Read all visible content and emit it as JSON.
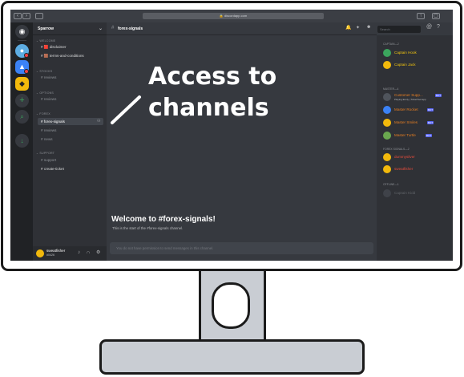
{
  "browser": {
    "url": "discordapp.com"
  },
  "server": {
    "name": "Sparrow"
  },
  "channel_list": {
    "categories": [
      {
        "label": "WELCOME",
        "channels": [
          "disclaimer",
          "terms-and-conditions"
        ]
      },
      {
        "label": "STOCKS",
        "channels": [
          "reviews"
        ]
      },
      {
        "label": "OPTIONS",
        "channels": [
          "reviews"
        ]
      },
      {
        "label": "FOREX",
        "channels": [
          "forex-signals",
          "reviews",
          "news"
        ]
      },
      {
        "label": "SUPPORT",
        "channels": [
          "support",
          "create-ticket"
        ]
      }
    ]
  },
  "header": {
    "channel": "forex-signals",
    "search_placeholder": "Search"
  },
  "overlay": {
    "line1": "Access to",
    "line2": "channels"
  },
  "welcome": {
    "title": "Welcome to #forex-signals!",
    "subtitle": "This is the start of the #forex-signals channel."
  },
  "composer": {
    "placeholder": "You do not have permission to send messages in this channel."
  },
  "user": {
    "name": "sweatfisher",
    "tag": "#0426"
  },
  "members": {
    "groups": [
      {
        "label": "CAPTAIN—2",
        "items": [
          {
            "name": "Captain Hook",
            "color": "#f1c40f",
            "tag": ""
          },
          {
            "name": "Captain Jack",
            "color": "#f1c40f",
            "tag": ""
          }
        ]
      },
      {
        "label": "MASTER—4",
        "items": [
          {
            "name": "Customer Supp...",
            "color": "#e67e22",
            "tag": "BOT",
            "sub": "Playing Emily | TicketTool.app"
          },
          {
            "name": "Master Rocket",
            "color": "#e67e22",
            "tag": "BOT"
          },
          {
            "name": "Master Smiles",
            "color": "#e67e22",
            "tag": "BOT"
          },
          {
            "name": "Master Turtle",
            "color": "#e67e22",
            "tag": "BOT"
          }
        ]
      },
      {
        "label": "FOREX SIGNALS—2",
        "items": [
          {
            "name": "dummysilver",
            "color": "#e74c3c",
            "tag": ""
          },
          {
            "name": "sweatfisher",
            "color": "#e74c3c",
            "tag": ""
          }
        ]
      },
      {
        "label": "OFFLINE—1",
        "items": [
          {
            "name": "Captain Kidd",
            "color": "#5c5f63",
            "tag": ""
          }
        ]
      }
    ]
  },
  "colors": {
    "discord_bg": "#36393f",
    "sidebar_bg": "#2f3136",
    "guild_bg": "#202225",
    "accent": "#5865f2",
    "monitor_stand": "#c9cdd3"
  }
}
